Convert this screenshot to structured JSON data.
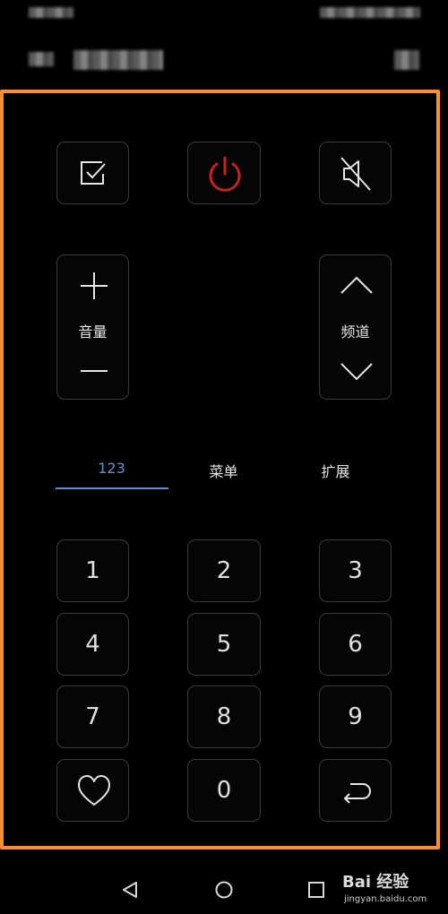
{
  "remote": {
    "volume_label": "音量",
    "channel_label": "频道"
  },
  "tabs": [
    {
      "label": "123",
      "active": true
    },
    {
      "label": "菜单",
      "active": false
    },
    {
      "label": "扩展",
      "active": false
    }
  ],
  "keypad": {
    "keys": [
      "1",
      "2",
      "3",
      "4",
      "5",
      "6",
      "7",
      "8",
      "9",
      "0"
    ]
  },
  "watermark": {
    "main": "Bai 经验",
    "sub": "jingyan.baidu.com"
  },
  "colors": {
    "accent": "#ff8c2e",
    "tab_active": "#5f8fd6",
    "power": "#c62020"
  },
  "icons": {
    "select": "checkbox-icon",
    "power": "power-icon",
    "mute": "mute-icon",
    "favorite": "heart-icon",
    "back": "return-icon"
  }
}
